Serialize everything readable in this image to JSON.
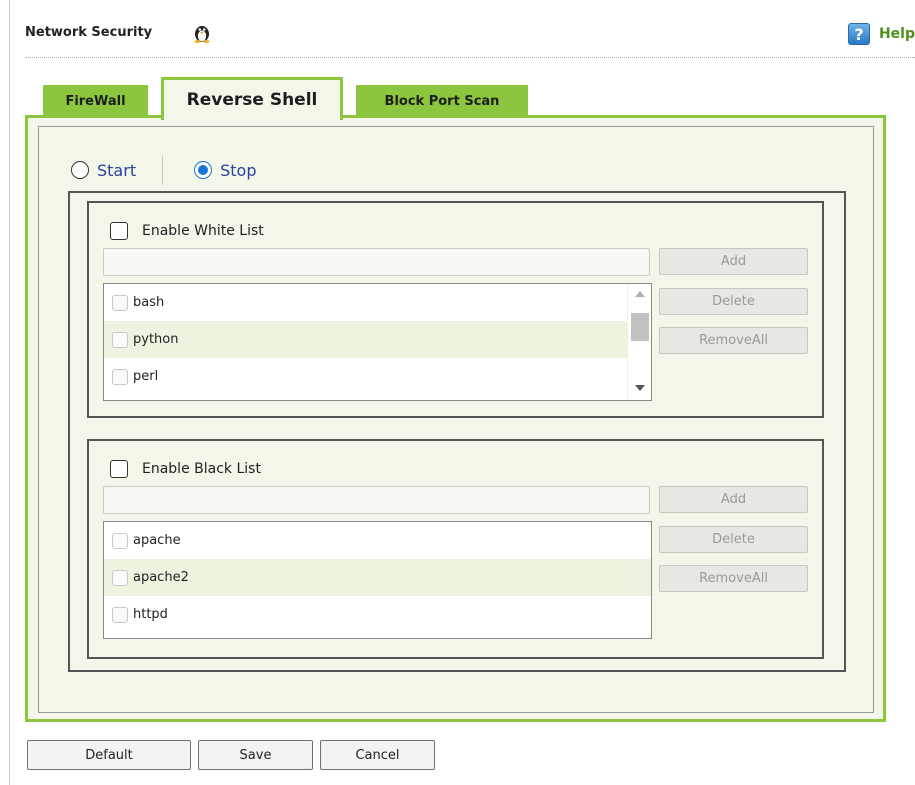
{
  "header": {
    "title": "Network Security",
    "title_icon": "linux-penguin-icon",
    "help_label": "Help",
    "help_icon": "question-mark-icon"
  },
  "tabs": [
    {
      "label": "FireWall",
      "active": false
    },
    {
      "label": "Reverse Shell",
      "active": true
    },
    {
      "label": "Block Port Scan",
      "active": false
    }
  ],
  "mode": {
    "start_label": "Start",
    "stop_label": "Stop",
    "selected": "Stop"
  },
  "white_list": {
    "enable_label": "Enable White List",
    "enabled": false,
    "input_value": "",
    "add_label": "Add",
    "delete_label": "Delete",
    "remove_all_label": "RemoveAll",
    "items": [
      "bash",
      "python",
      "perl"
    ]
  },
  "black_list": {
    "enable_label": "Enable Black List",
    "enabled": false,
    "input_value": "",
    "add_label": "Add",
    "delete_label": "Delete",
    "remove_all_label": "RemoveAll",
    "items": [
      "apache",
      "apache2",
      "httpd"
    ]
  },
  "footer": {
    "default_label": "Default",
    "save_label": "Save",
    "cancel_label": "Cancel"
  },
  "colors": {
    "accent_green": "#8cc63f",
    "panel_background": "#f2f7ea",
    "radio_blue": "#1a73d6",
    "help_green": "#4f8f1c"
  }
}
